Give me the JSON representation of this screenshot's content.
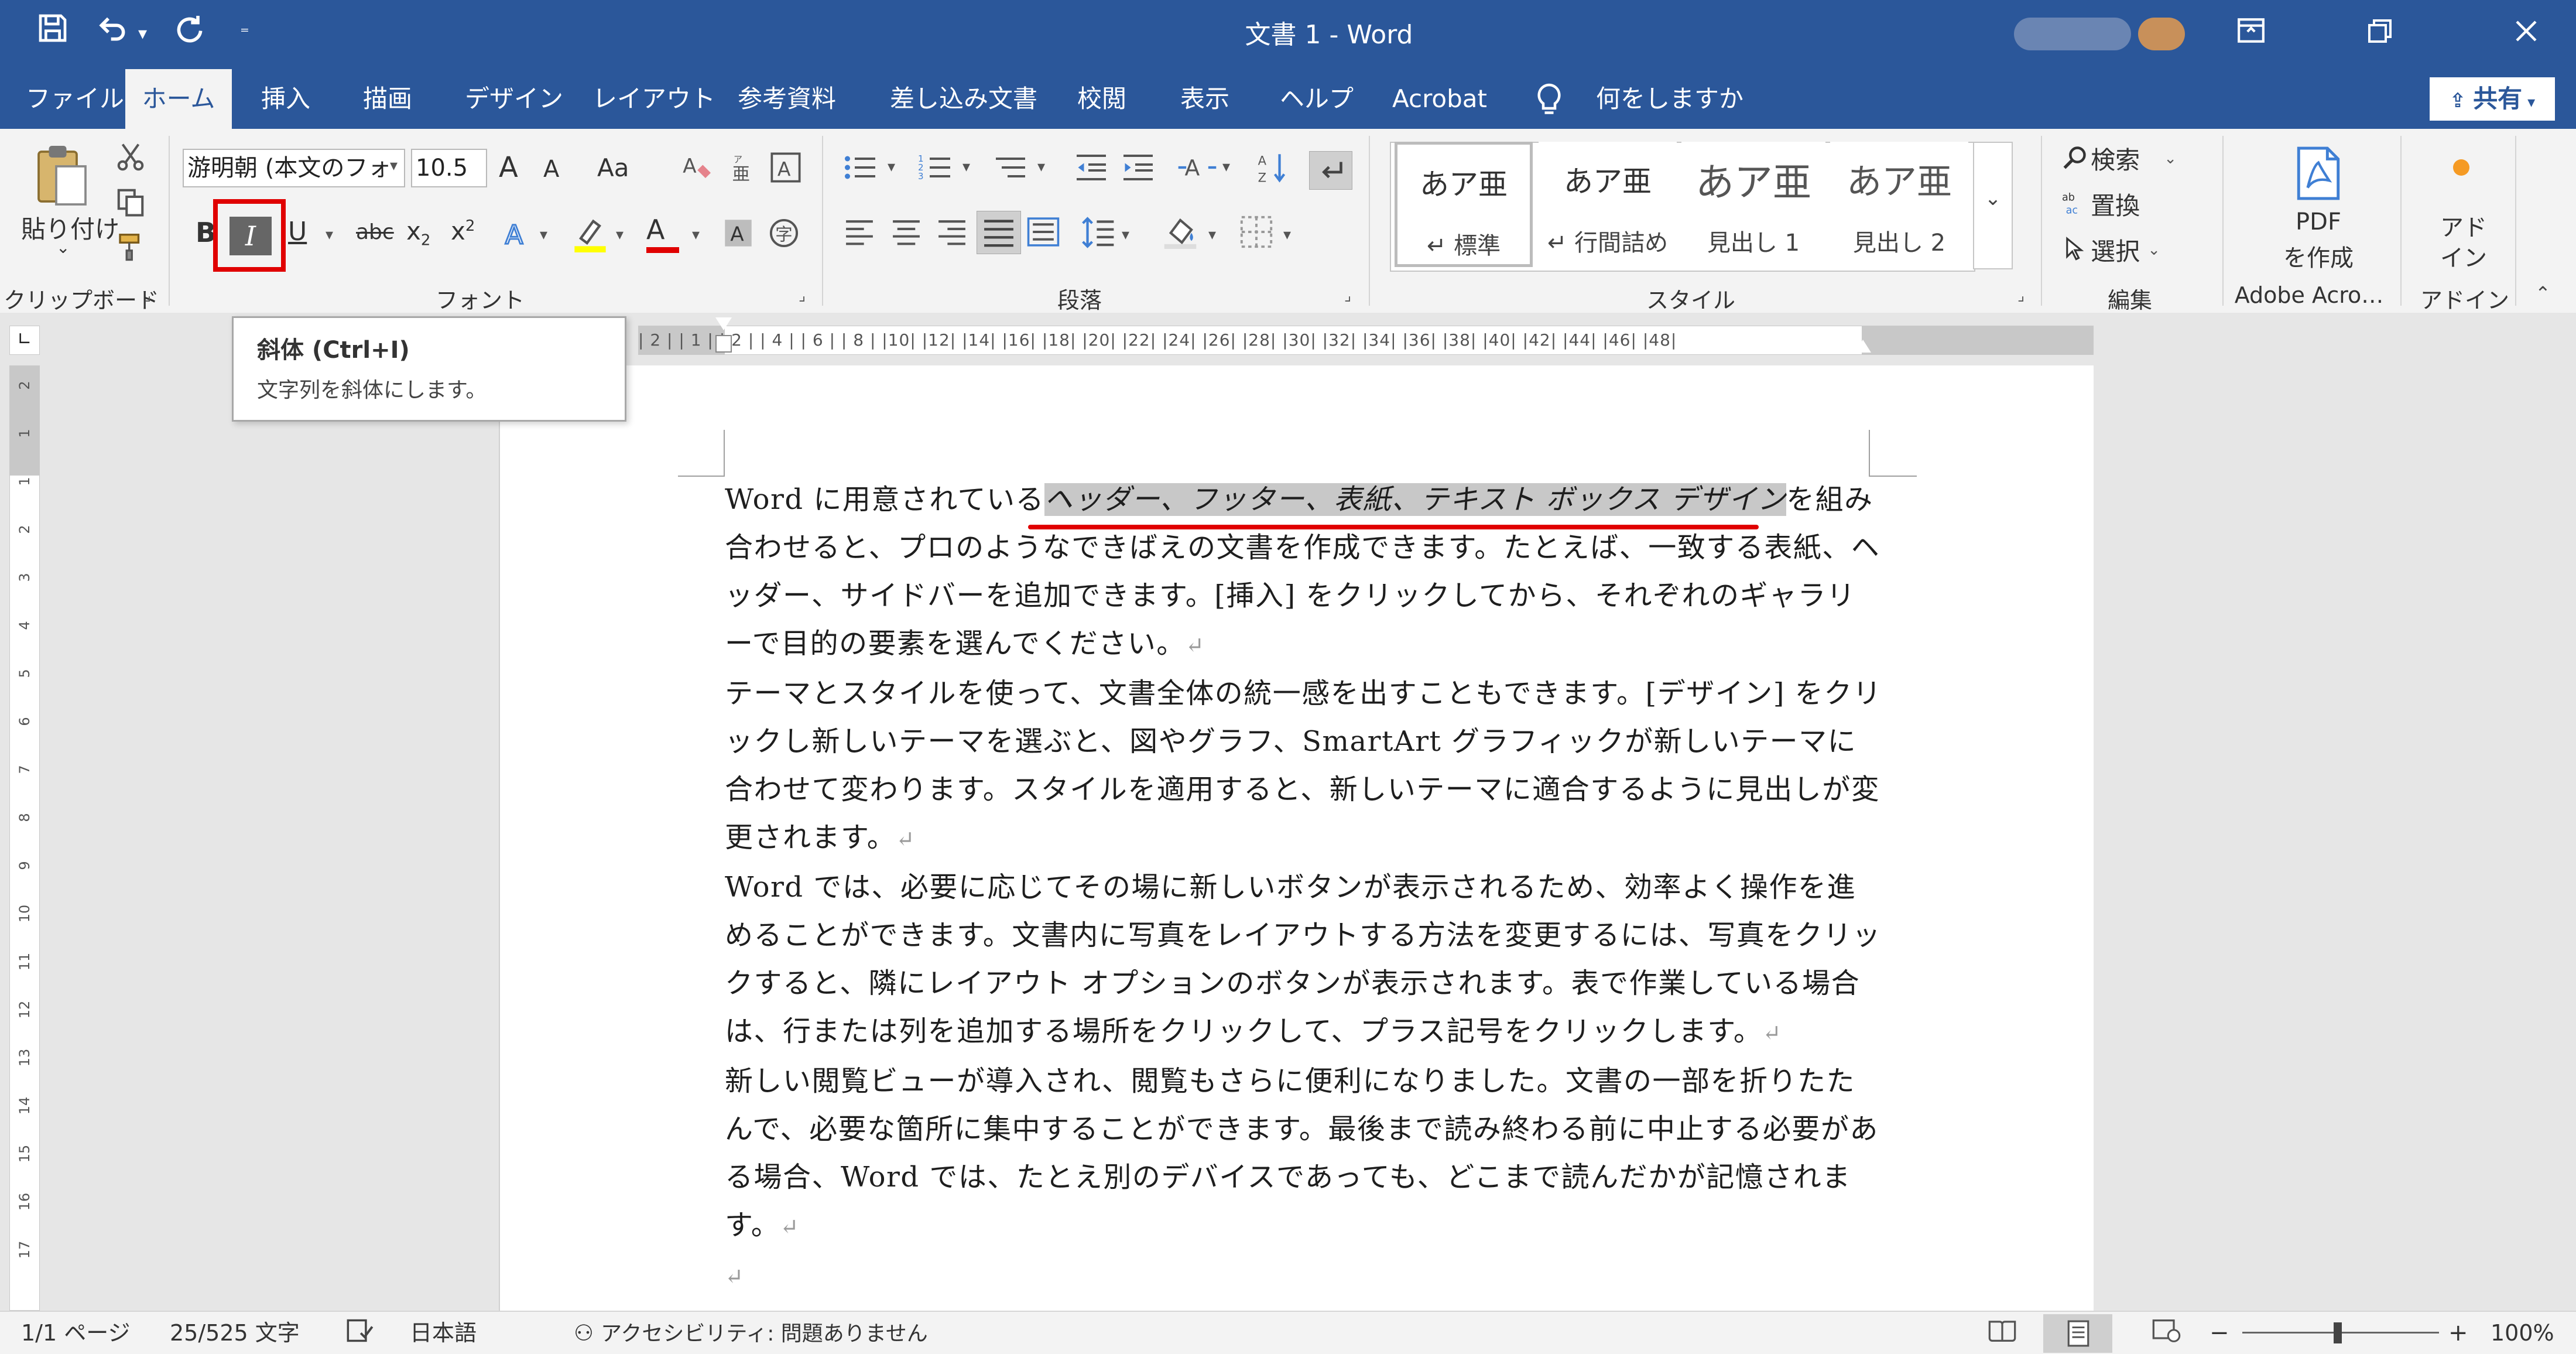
{
  "titlebar": {
    "title": "文書 1  -  Word",
    "quick_access": {
      "save_icon": "save-icon",
      "undo_icon": "undo-icon",
      "redo_icon": "redo-icon",
      "customize_icon": "customize-qat-icon"
    },
    "window_buttons": {
      "ribbon_display_icon": "ribbon-display-options-icon",
      "restore_icon": "restore-icon",
      "close_icon": "close-icon"
    }
  },
  "tabs": [
    "ファイル",
    "ホーム",
    "挿入",
    "描画",
    "デザイン",
    "レイアウト",
    "参考資料",
    "差し込み文書",
    "校閲",
    "表示",
    "ヘルプ",
    "Acrobat"
  ],
  "active_tab": "ホーム",
  "tell_me": "何をしますか",
  "share_label": "共有",
  "ribbon": {
    "clipboard": {
      "paste_label": "貼り付け",
      "group_label": "クリップボード"
    },
    "font": {
      "font_name": "游明朝 (本文のフォ",
      "font_size": "10.5",
      "grow": "A",
      "shrink": "A",
      "change_case": "Aa",
      "bold": "B",
      "italic": "I",
      "underline": "U",
      "strikethrough": "abc",
      "subscript": "x",
      "subscript_mark": "2",
      "superscript": "x",
      "superscript_mark": "2",
      "font_color_letter": "A",
      "group_label": "フォント"
    },
    "paragraph": {
      "group_label": "段落"
    },
    "styles": {
      "cards": [
        {
          "preview": "あア亜",
          "label": "↵ 標準"
        },
        {
          "preview": "あア亜",
          "label": "↵ 行間詰め"
        },
        {
          "preview": "あア亜",
          "label": "見出し 1"
        },
        {
          "preview": "あア亜",
          "label": "見出し 2"
        }
      ],
      "group_label": "スタイル"
    },
    "editing": {
      "find": "検索",
      "replace": "置換",
      "select": "選択",
      "group_label": "編集"
    },
    "adobe": {
      "create_pdf_line1": "PDF",
      "create_pdf_line2": "を作成",
      "group_label": "Adobe Acro…"
    },
    "addin": {
      "line1": "アド",
      "line2": "イン",
      "group_label": "アドイン"
    }
  },
  "tooltip": {
    "title": "斜体 (Ctrl+I)",
    "description": "文字列を斜体にします。"
  },
  "ruler": {
    "horizontal_ticks": "| 2 |   | 1 |        | 2 |    | 4 |    | 6 |    | 8 |   |10|   |12|   |14|   |16|   |18|   |20|   |22|   |24|   |26|   |28|   |30|   |32|   |34|   |36|   |38|   |40|   |42|   |44|   |46|   |48|",
    "vertical_ticks": [
      "2",
      "1",
      "1",
      "2",
      "3",
      "4",
      "5",
      "6",
      "7",
      "8",
      "9",
      "10",
      "11",
      "12",
      "13",
      "14",
      "15",
      "16",
      "17"
    ]
  },
  "document": {
    "paragraphs": [
      {
        "before": "Word に用意されている",
        "selected": "ヘッダー、フッター、表紙、テキスト ボックス デザイン",
        "after": "を組み合わせると、プロのようなできばえの文書を作成できます。たとえば、一致する表紙、ヘッダー、サイドバーを追加できます。[挿入] をクリックしてから、それぞれのギャラリーで目的の要素を選んでください。"
      },
      {
        "text": "テーマとスタイルを使って、文書全体の統一感を出すこともできます。[デザイン] をクリックし新しいテーマを選ぶと、図やグラフ、SmartArt グラフィックが新しいテーマに合わせて変わります。スタイルを適用すると、新しいテーマに適合するように見出しが変更されます。"
      },
      {
        "text": "Word では、必要に応じてその場に新しいボタンが表示されるため、効率よく操作を進めることができます。文書内に写真をレイアウトする方法を変更するには、写真をクリックすると、隣にレイアウト オプションのボタンが表示されます。表で作業している場合は、行または列を追加する場所をクリックして、プラス記号をクリックします。"
      },
      {
        "text": "新しい閲覧ビューが導入され、閲覧もさらに便利になりました。文書の一部を折りたたんで、必要な箇所に集中することができます。最後まで読み終わる前に中止する必要がある場合、Word では、たとえ別のデバイスであっても、どこまで読んだかが記憶されます。"
      }
    ],
    "paragraph_mark": "↵"
  },
  "statusbar": {
    "page": "1/1 ページ",
    "words": "25/525 文字",
    "language": "日本語",
    "accessibility": "アクセシビリティ: 問題ありません",
    "zoom": "100%"
  },
  "colors": {
    "accent": "#2b579a",
    "highlight_red": "#e00000",
    "selection": "#c8c8c8"
  }
}
